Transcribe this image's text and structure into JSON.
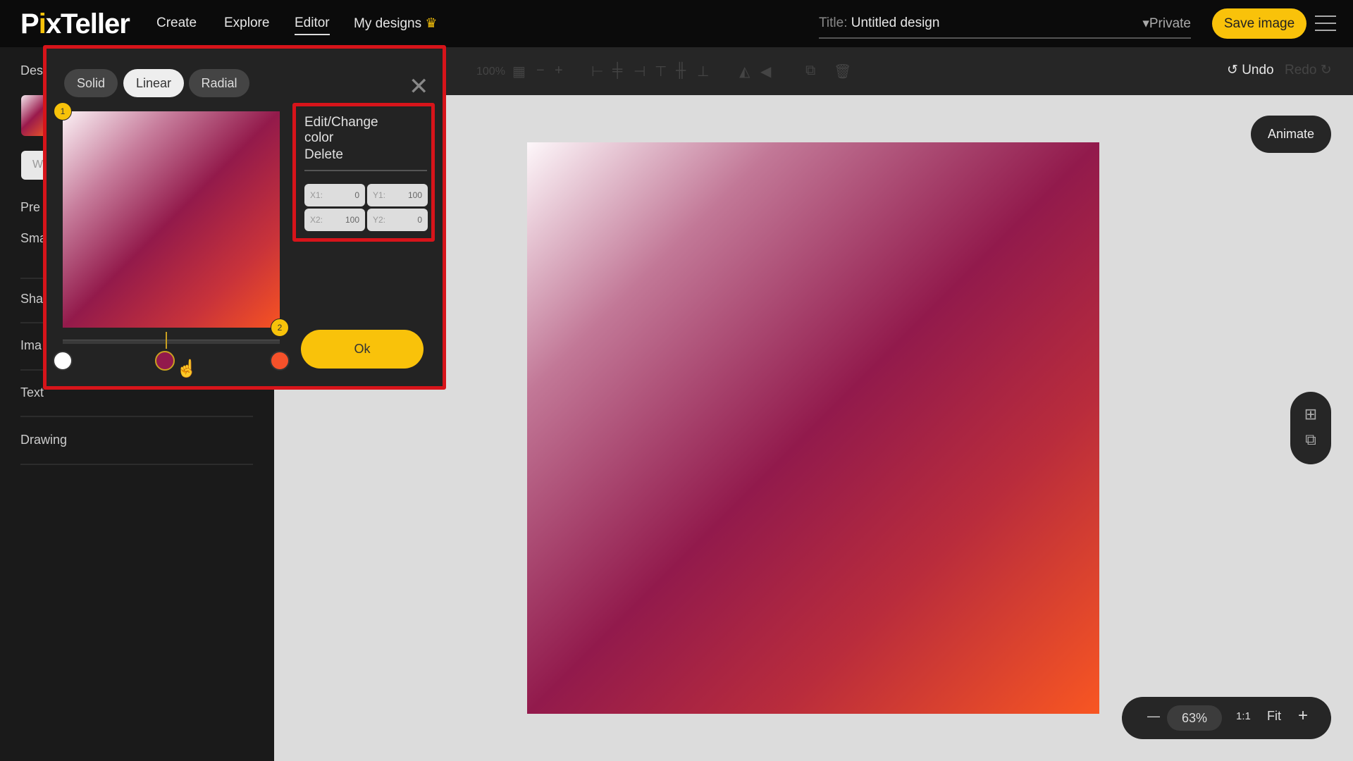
{
  "header": {
    "logo": "PixTeller",
    "nav": [
      {
        "label": "Create"
      },
      {
        "label": "Explore"
      },
      {
        "label": "Editor",
        "active": true
      },
      {
        "label": "My designs"
      }
    ],
    "title_label": "Title:",
    "title_value": "Untitled design",
    "privacy": "Private",
    "save": "Save image"
  },
  "toolbar": {
    "zoom": "100%",
    "undo": "Undo",
    "redo": "Redo"
  },
  "sidebar": {
    "items": [
      "Des",
      "W",
      "Pre",
      "Sma",
      "Sha",
      "Ima",
      "Text",
      "Drawing"
    ]
  },
  "canvas": {
    "animate": "Animate",
    "zoom": {
      "value": "63%",
      "one_to_one": "1:1",
      "fit": "Fit"
    }
  },
  "popup": {
    "tabs": [
      "Solid",
      "Linear",
      "Radial"
    ],
    "active_tab": "Linear",
    "badges": [
      "1",
      "2"
    ],
    "stops": [
      {
        "color": "#ffffff",
        "position": 0
      },
      {
        "color": "#921a4c",
        "position": 47
      },
      {
        "color": "#f5512a",
        "position": 100
      }
    ],
    "context_menu": {
      "edit": "Edit/Change color",
      "delete": "Delete"
    },
    "coords": {
      "x1_label": "X1:",
      "x1": "0",
      "y1_label": "Y1:",
      "y1": "100",
      "x2_label": "X2:",
      "x2": "100",
      "y2_label": "Y2:",
      "y2": "0"
    },
    "ok": "Ok"
  },
  "colors": {
    "accent": "#f9c20a",
    "highlight": "#d7141a"
  }
}
